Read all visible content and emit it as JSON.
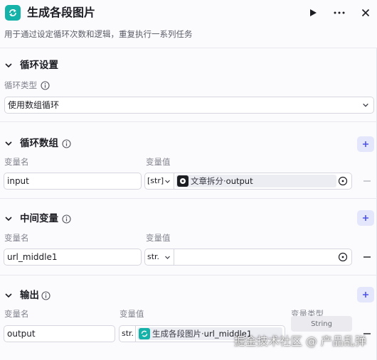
{
  "header": {
    "title": "生成各段图片",
    "description": "用于通过设定循环次数和逻辑，重复执行一系列任务",
    "icon": "loop-icon",
    "accent": "#14b2a8"
  },
  "loop_settings": {
    "title": "循环设置",
    "type_label": "循环类型",
    "type_value": "使用数组循环"
  },
  "loop_array": {
    "title": "循环数组",
    "col_name": "变量名",
    "col_value": "变量值",
    "row": {
      "name": "input",
      "type": "[str]",
      "ref_source": "文章拆分",
      "ref_sep": " · ",
      "ref_output": "output"
    }
  },
  "intermediate": {
    "title": "中间变量",
    "col_name": "变量名",
    "col_value": "变量值",
    "row": {
      "name": "url_middle1",
      "type": "str."
    }
  },
  "output": {
    "title": "输出",
    "col_name": "变量名",
    "col_value": "变量值",
    "col_type": "变量类型",
    "row": {
      "name": "output",
      "type": "str.",
      "ref_source": "生成各段图片",
      "ref_sep": " · ",
      "ref_output": "url_middle1",
      "var_type": "String"
    }
  },
  "watermark": "掘金技术社区 @ 产品乱弹"
}
